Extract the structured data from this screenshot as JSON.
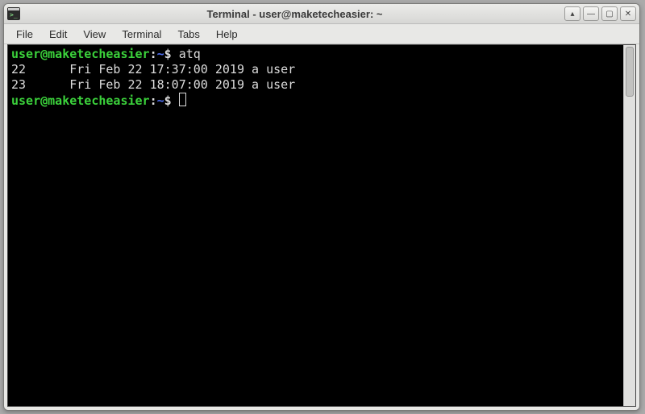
{
  "window": {
    "title": "Terminal - user@maketecheasier: ~"
  },
  "menubar": {
    "items": [
      "File",
      "Edit",
      "View",
      "Terminal",
      "Tabs",
      "Help"
    ]
  },
  "prompt": {
    "user_host": "user@maketecheasier",
    "colon": ":",
    "path": "~",
    "symbol": "$"
  },
  "session": {
    "command": "atq",
    "output_lines": [
      "22      Fri Feb 22 17:37:00 2019 a user",
      "23      Fri Feb 22 18:07:00 2019 a user"
    ]
  },
  "icons": {
    "stick": "▴",
    "minimize": "—",
    "maximize": "▢",
    "close": "✕"
  }
}
